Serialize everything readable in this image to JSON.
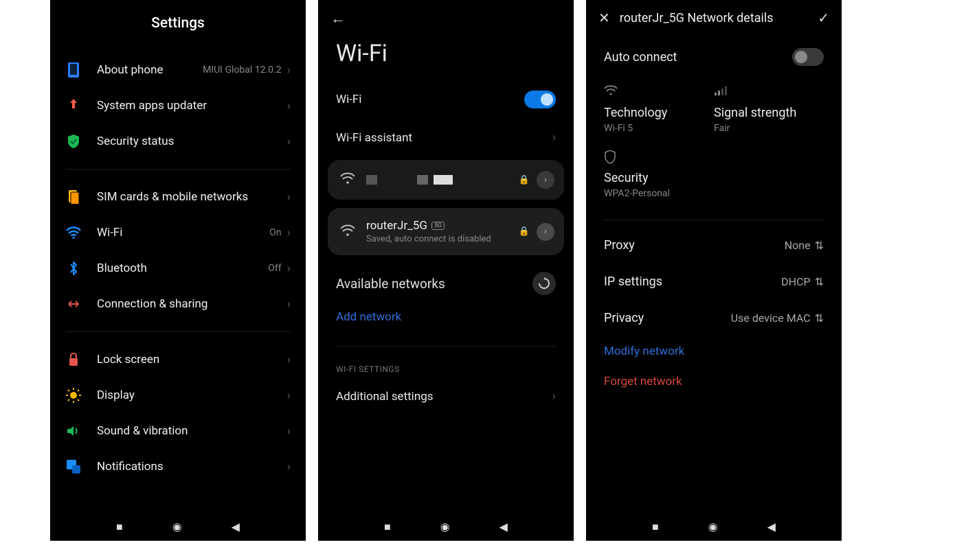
{
  "screen1": {
    "title": "Settings",
    "items": [
      {
        "label": "About phone",
        "value": "MIUI Global 12.0.2",
        "icon": "phone"
      },
      {
        "label": "System apps updater",
        "value": "",
        "icon": "update"
      },
      {
        "label": "Security status",
        "value": "",
        "icon": "security"
      }
    ],
    "group2": [
      {
        "label": "SIM cards & mobile networks",
        "value": "",
        "icon": "sim"
      },
      {
        "label": "Wi-Fi",
        "value": "On",
        "icon": "wifi"
      },
      {
        "label": "Bluetooth",
        "value": "Off",
        "icon": "bluetooth"
      },
      {
        "label": "Connection & sharing",
        "value": "",
        "icon": "connection"
      }
    ],
    "group3": [
      {
        "label": "Lock screen",
        "icon": "lock"
      },
      {
        "label": "Display",
        "icon": "display"
      },
      {
        "label": "Sound & vibration",
        "icon": "sound"
      },
      {
        "label": "Notifications",
        "icon": "notifications"
      }
    ]
  },
  "screen2": {
    "title": "Wi-Fi",
    "wifi_label": "Wi-Fi",
    "wifi_on": true,
    "assistant_label": "Wi-Fi assistant",
    "net2": {
      "name": "routerJr_5G",
      "badge": "5G",
      "sub": "Saved, auto connect is disabled"
    },
    "available_label": "Available networks",
    "add_label": "Add network",
    "settings_head": "WI-FI SETTINGS",
    "additional_label": "Additional settings"
  },
  "screen3": {
    "title": "routerJr_5G Network details",
    "auto_connect_label": "Auto connect",
    "auto_connect_on": false,
    "tech_label": "Technology",
    "tech_value": "Wi-Fi 5",
    "signal_label": "Signal strength",
    "signal_value": "Fair",
    "security_label": "Security",
    "security_value": "WPA2-Personal",
    "proxy_label": "Proxy",
    "proxy_value": "None",
    "ip_label": "IP settings",
    "ip_value": "DHCP",
    "privacy_label": "Privacy",
    "privacy_value": "Use device MAC",
    "modify_label": "Modify network",
    "forget_label": "Forget network"
  }
}
